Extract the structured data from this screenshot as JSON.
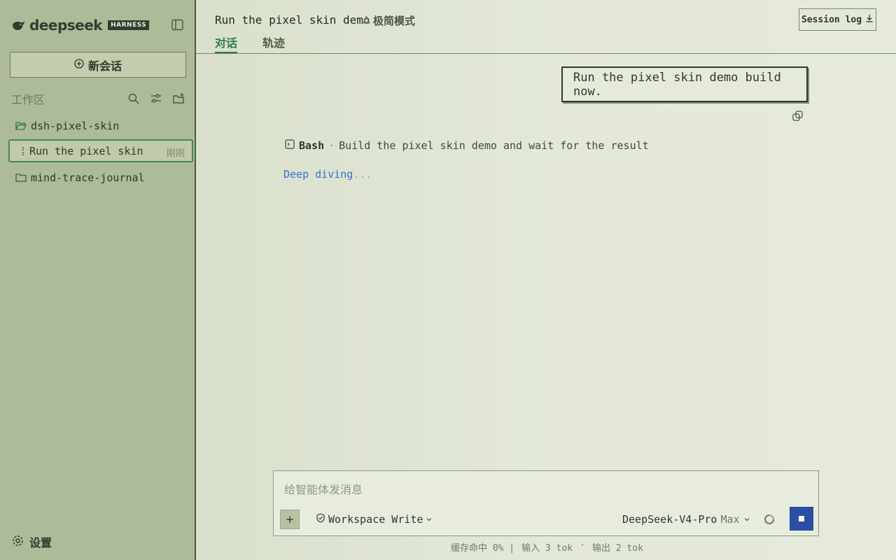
{
  "brand": {
    "name": "deepseek",
    "badge": "HARNESS"
  },
  "sidebar": {
    "new_chat_label": "新会话",
    "workspace_label": "工作区",
    "items": [
      {
        "type": "folder",
        "label": "dsh-pixel-skin",
        "open": true
      },
      {
        "type": "session",
        "label": "Run the pixel skin d…",
        "time": "刚刚",
        "active": true
      },
      {
        "type": "folder",
        "label": "mind-trace-journal",
        "open": false
      }
    ],
    "settings_label": "设置"
  },
  "header": {
    "title": "Run the pixel skin demo",
    "mode_label": "极简模式",
    "tabs": [
      {
        "label": "对话",
        "active": true
      },
      {
        "label": "轨迹",
        "active": false
      }
    ],
    "session_log_label": "Session log"
  },
  "conversation": {
    "user_message": "Run the pixel skin demo build now.",
    "tool_name": "Bash",
    "tool_separator": "·",
    "tool_description": "Build the pixel skin demo and wait for the result",
    "thinking_text": "Deep diving",
    "thinking_dots": "..."
  },
  "composer": {
    "placeholder": "给智能体发消息",
    "attach_label": "+",
    "permission_label": "Workspace Write",
    "model_name": "DeepSeek-V4-Pro",
    "model_tier": "Max"
  },
  "usage": {
    "cache": "缓存命中 0% |",
    "input": "输入 3 tok",
    "dot": "·",
    "output": "输出 2 tok"
  },
  "colors": {
    "sidebar_bg": "#aebb98",
    "accent_green": "#2e7d46",
    "thinking_blue": "#3b6fd6",
    "stop_button": "#2a4ea3"
  },
  "icons": [
    "deepseek-whale-icon",
    "sidebar-toggle-icon",
    "plus-circle-icon",
    "search-icon",
    "filter-icon",
    "new-folder-icon",
    "folder-open-icon",
    "folder-icon",
    "gear-icon",
    "recycle-icon",
    "download-icon",
    "copy-icon",
    "terminal-icon",
    "shield-check-icon",
    "chevron-down-icon",
    "status-ring-icon",
    "stop-icon"
  ]
}
